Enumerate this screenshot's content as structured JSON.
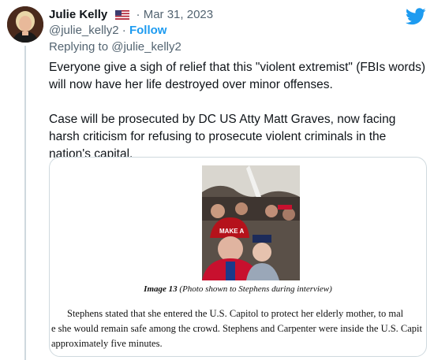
{
  "tweet": {
    "author_name": "Julie Kelly",
    "flag_icon": "us-flag-icon",
    "separator": "·",
    "date": "Mar 31, 2023",
    "handle": "@julie_kelly2",
    "dot": "·",
    "follow_label": "Follow",
    "replying_prefix": "Replying to",
    "replying_to": "@julie_kelly2",
    "paragraphs": [
      "Everyone give a sigh of relief that this \"violent extremist\" (FBIs words) will now have her life destroyed over minor offenses.",
      "Case will be prosecuted by DC US Atty Matt Graves, now facing harsh criticism for refusing to prosecute violent criminals in the nation's capital."
    ],
    "brand_icon": "twitter-bird-icon",
    "brand_color": "#1d9bf0"
  },
  "media": {
    "caption_label": "Image 13",
    "caption_text": "(Photo shown to Stephens during interview)",
    "doc_lines": [
      "Stephens stated that she entered the U.S. Capitol to protect her elderly mother, to mal",
      "e she would remain safe among the crowd. Stephens and Carpenter were inside the U.S. Capit",
      "approximately five minutes."
    ],
    "photo_hat_text": "MAKE A"
  }
}
